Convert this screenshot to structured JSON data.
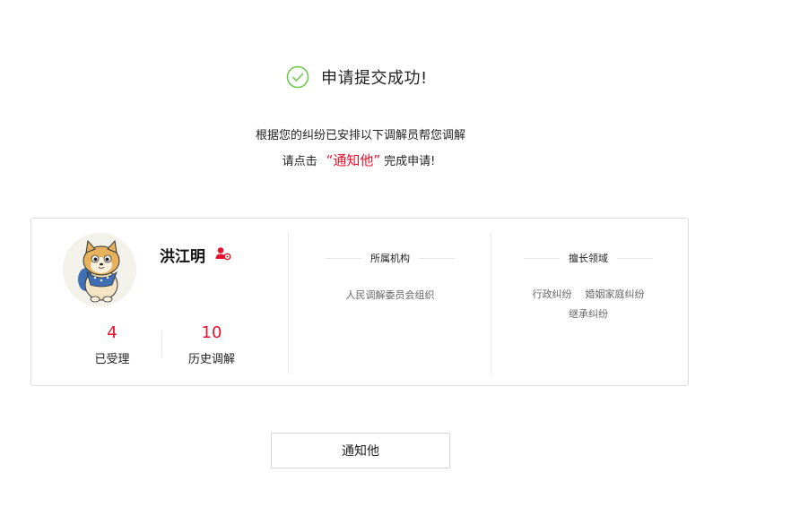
{
  "success": {
    "title": "申请提交成功!"
  },
  "message": {
    "line1": "根据您的纠纷已安排以下调解员帮您调解",
    "line2_prefix": "请点击",
    "line2_highlight": "“通知他”",
    "line2_suffix": "完成申请!"
  },
  "mediator": {
    "name": "洪江明",
    "stats": [
      {
        "value": "4",
        "label": "已受理"
      },
      {
        "value": "10",
        "label": "历史调解"
      }
    ],
    "organization": {
      "title": "所属机构",
      "value": "人民调解委员会组织"
    },
    "expertise": {
      "title": "擅长领域",
      "items": [
        "行政纠纷",
        "婚姻家庭纠纷",
        "继承纠纷"
      ]
    }
  },
  "actions": {
    "notify_label": "通知他"
  },
  "colors": {
    "accent": "#e8102b",
    "success": "#6ccb4e",
    "border": "#dcdcdc"
  },
  "icons": {
    "success": "check-circle-icon",
    "mediator_badge": "person-badge-icon",
    "avatar": "cartoon-dog-avatar"
  }
}
